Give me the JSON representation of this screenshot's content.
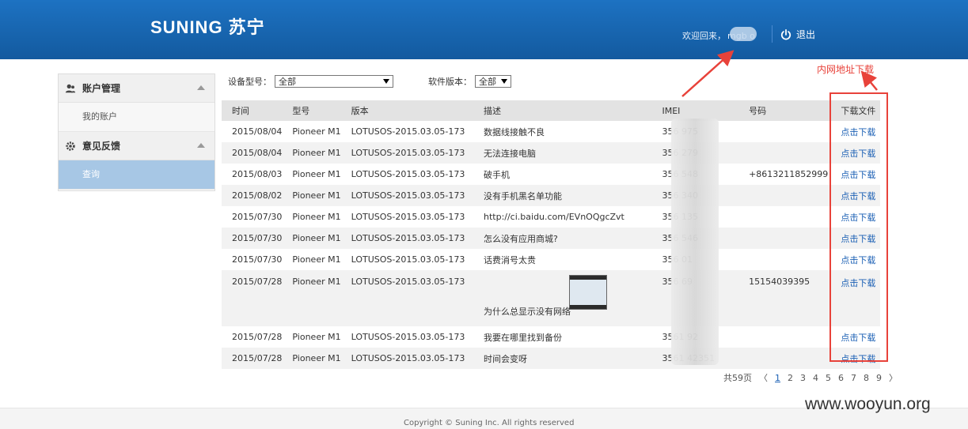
{
  "header": {
    "logo_text": "SUNING 苏宁",
    "welcome_prefix": "欢迎回来，",
    "username_masked": "mgb   o",
    "logout_label": "退出"
  },
  "sidebar": {
    "groups": [
      {
        "title": "账户管理",
        "icon": "users-icon",
        "items": [
          "我的账户"
        ]
      },
      {
        "title": "意见反馈",
        "icon": "gear-icon",
        "items": [
          "查询"
        ]
      }
    ]
  },
  "filters": {
    "device_label": "设备型号：",
    "device_value": "全部",
    "version_label": "软件版本：",
    "version_value": "全部"
  },
  "table": {
    "headers": [
      "时间",
      "型号",
      "版本",
      "描述",
      "IMEI",
      "号码",
      "下载文件"
    ],
    "rows": [
      {
        "date": "2015/08/04",
        "model": "Pioneer M1",
        "version": "LOTUSOS-2015.03.05-173",
        "desc": "数据线接触不良",
        "imei": "356         975",
        "phone": "",
        "link": "点击下载"
      },
      {
        "date": "2015/08/04",
        "model": "Pioneer M1",
        "version": "LOTUSOS-2015.03.05-173",
        "desc": "无法连接电脑",
        "imei": "356         279",
        "phone": "",
        "link": "点击下载"
      },
      {
        "date": "2015/08/03",
        "model": "Pioneer M1",
        "version": "LOTUSOS-2015.03.05-173",
        "desc": "破手机",
        "imei": "356         548",
        "phone": "+8613211852999",
        "link": "点击下载"
      },
      {
        "date": "2015/08/02",
        "model": "Pioneer M1",
        "version": "LOTUSOS-2015.03.05-173",
        "desc": "没有手机黑名单功能",
        "imei": "356         340",
        "phone": "",
        "link": "点击下载"
      },
      {
        "date": "2015/07/30",
        "model": "Pioneer M1",
        "version": "LOTUSOS-2015.03.05-173",
        "desc": "http://ci.baidu.com/EVnOQgcZvt",
        "imei": "356         135",
        "phone": "",
        "link": "点击下载"
      },
      {
        "date": "2015/07/30",
        "model": "Pioneer M1",
        "version": "LOTUSOS-2015.03.05-173",
        "desc": "怎么没有应用商城?",
        "imei": "356         546",
        "phone": "",
        "link": "点击下载"
      },
      {
        "date": "2015/07/30",
        "model": "Pioneer M1",
        "version": "LOTUSOS-2015.03.05-173",
        "desc": "话费消号太贵",
        "imei": "356         01",
        "phone": "",
        "link": "点击下载"
      },
      {
        "date": "2015/07/28",
        "model": "Pioneer M1",
        "version": "LOTUSOS-2015.03.05-173",
        "desc": "为什么总显示没有网络",
        "imei": "356         69",
        "phone": "15154039395",
        "link": "点击下载",
        "has_thumb": true
      },
      {
        "date": "2015/07/28",
        "model": "Pioneer M1",
        "version": "LOTUSOS-2015.03.05-173",
        "desc": "我要在哪里找到备份",
        "imei": "3561        92",
        "phone": "",
        "link": "点击下载"
      },
      {
        "date": "2015/07/28",
        "model": "Pioneer M1",
        "version": "LOTUSOS-2015.03.05-173",
        "desc": "时间会变呀",
        "imei": "3561      42351",
        "phone": "",
        "link": "点击下载"
      }
    ]
  },
  "pagination": {
    "total": "共59页",
    "prev": "〈",
    "pages": [
      "1",
      "2",
      "3",
      "4",
      "5",
      "6",
      "7",
      "8",
      "9"
    ],
    "current": "1",
    "next": "〉"
  },
  "annotation": {
    "label": "内网地址下载",
    "color": "#e8423a"
  },
  "footer": {
    "copyright": "Copyright © Suning Inc. All rights reserved"
  },
  "watermark": "www.wooyun.org"
}
